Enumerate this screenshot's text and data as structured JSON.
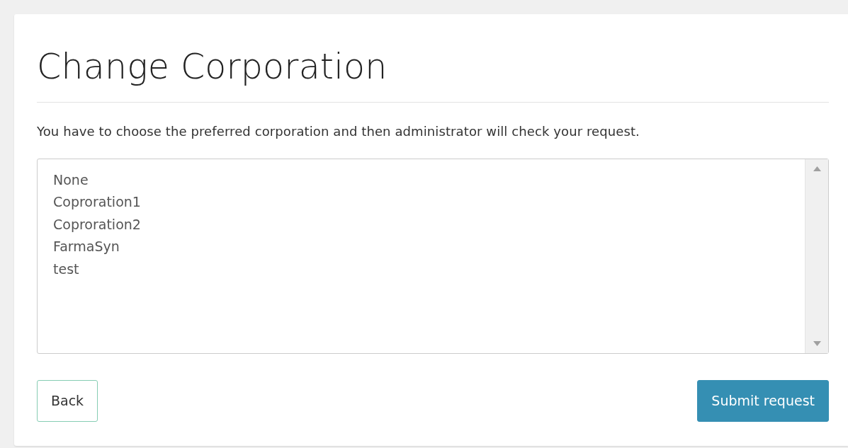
{
  "title": "Change Corporation",
  "description": "You have to choose the preferred corporation and then administrator will check your request.",
  "corporation_list": {
    "options": [
      "None",
      "Coproration1",
      "Coproration2",
      "FarmaSyn",
      "test"
    ]
  },
  "buttons": {
    "back": "Back",
    "submit": "Submit request"
  }
}
